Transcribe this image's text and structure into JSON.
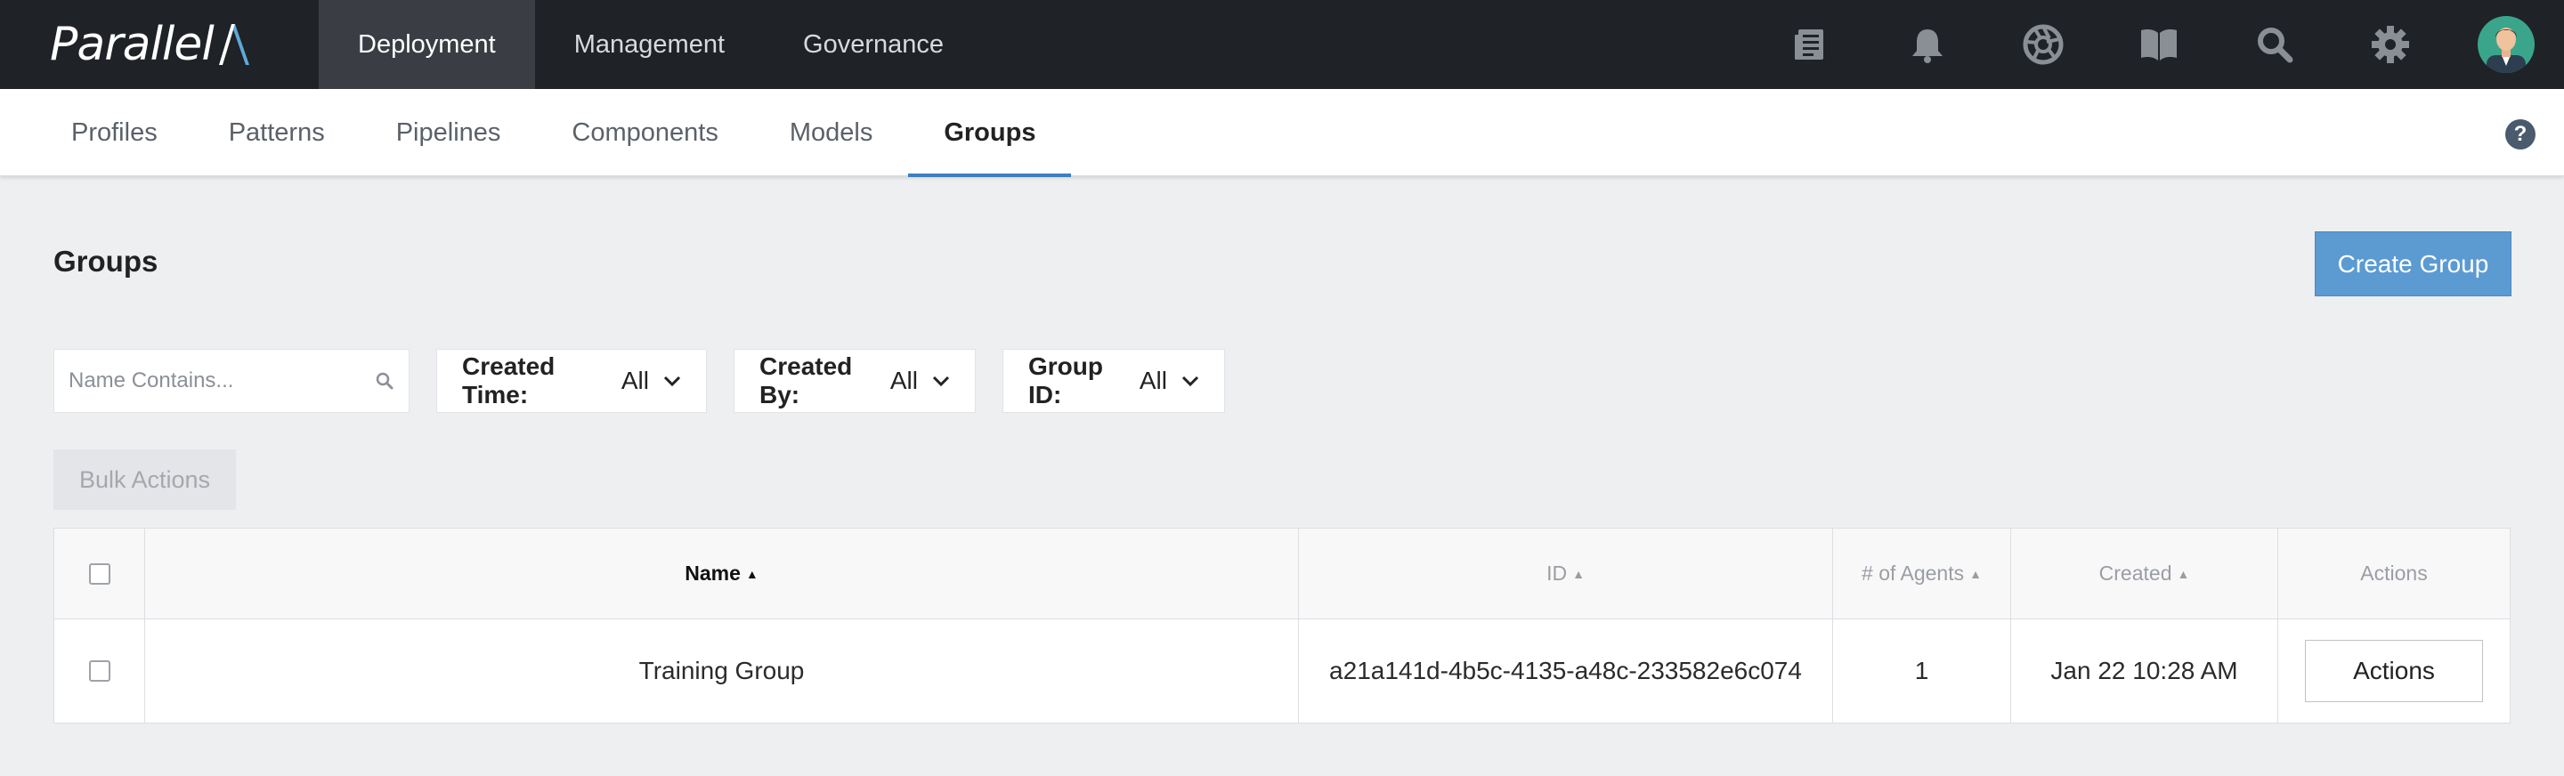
{
  "brand": {
    "logo_text": "Parallel",
    "logo_mark_color": "#5fa8d8"
  },
  "topnav": {
    "items": [
      {
        "label": "Deployment",
        "active": true
      },
      {
        "label": "Management",
        "active": false
      },
      {
        "label": "Governance",
        "active": false
      }
    ],
    "icons": [
      "document-icon",
      "bell-icon",
      "aperture-icon",
      "book-icon",
      "search-icon",
      "gear-icon",
      "avatar"
    ]
  },
  "subnav": {
    "items": [
      {
        "label": "Profiles",
        "active": false
      },
      {
        "label": "Patterns",
        "active": false
      },
      {
        "label": "Pipelines",
        "active": false
      },
      {
        "label": "Components",
        "active": false
      },
      {
        "label": "Models",
        "active": false
      },
      {
        "label": "Groups",
        "active": true
      }
    ],
    "help_label": "?"
  },
  "page": {
    "title": "Groups",
    "create_button": "Create Group"
  },
  "filters": {
    "search_placeholder": "Name Contains...",
    "created_time": {
      "label": "Created Time:",
      "value": "All"
    },
    "created_by": {
      "label": "Created By:",
      "value": "All"
    },
    "group_id": {
      "label": "Group ID:",
      "value": "All"
    }
  },
  "bulk_actions": "Bulk Actions",
  "table": {
    "columns": {
      "name": "Name",
      "id": "ID",
      "agents": "# of Agents",
      "created": "Created",
      "actions": "Actions"
    },
    "rows": [
      {
        "name": "Training Group",
        "id": "a21a141d-4b5c-4135-a48c-233582e6c074",
        "agents": "1",
        "created": "Jan 22 10:28 AM",
        "action_label": "Actions"
      }
    ]
  },
  "colors": {
    "topbar": "#1f2226",
    "accent": "#3d7fbf",
    "primary_button": "#5b9bd2",
    "background": "#eeeff1"
  }
}
